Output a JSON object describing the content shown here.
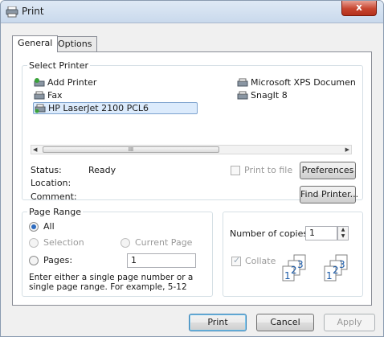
{
  "window": {
    "title": "Print",
    "close_glyph": "x"
  },
  "tabs": [
    {
      "label": "General",
      "active": true
    },
    {
      "label": "Options",
      "active": false
    }
  ],
  "select_printer": {
    "legend": "Select Printer",
    "printers": [
      {
        "name": "Add Printer",
        "icon": "add-printer-icon"
      },
      {
        "name": "Fax",
        "icon": "fax-icon"
      },
      {
        "name": "HP LaserJet 2100 PCL6",
        "icon": "printer-icon",
        "selected": true
      },
      {
        "name": "Microsoft XPS Documen",
        "icon": "printer-icon"
      },
      {
        "name": "SnagIt 8",
        "icon": "printer-icon"
      }
    ],
    "scroll_left": "◀",
    "scroll_right": "▶",
    "scroll_grip": "III",
    "status_label": "Status:",
    "status_value": "Ready",
    "location_label": "Location:",
    "location_value": "",
    "comment_label": "Comment:",
    "comment_value": "",
    "print_to_file": "Print to file",
    "preferences": "Preferences",
    "find_printer": "Find Printer..."
  },
  "page_range": {
    "legend": "Page Range",
    "all": "All",
    "selection": "Selection",
    "current_page": "Current Page",
    "pages": "Pages:",
    "pages_value": "1",
    "hint": "Enter either a single page number or a single page range.  For example, 5-12"
  },
  "copies": {
    "label": "Number of copies:",
    "value": "1",
    "collate": "Collate",
    "collate_checked": true,
    "spin_up": "▲",
    "spin_down": "▼"
  },
  "footer": {
    "print": "Print",
    "cancel": "Cancel",
    "apply": "Apply"
  },
  "colors": {
    "accent": "#2d6bbf",
    "close": "#c7452f",
    "selection": "#dcebfc"
  }
}
